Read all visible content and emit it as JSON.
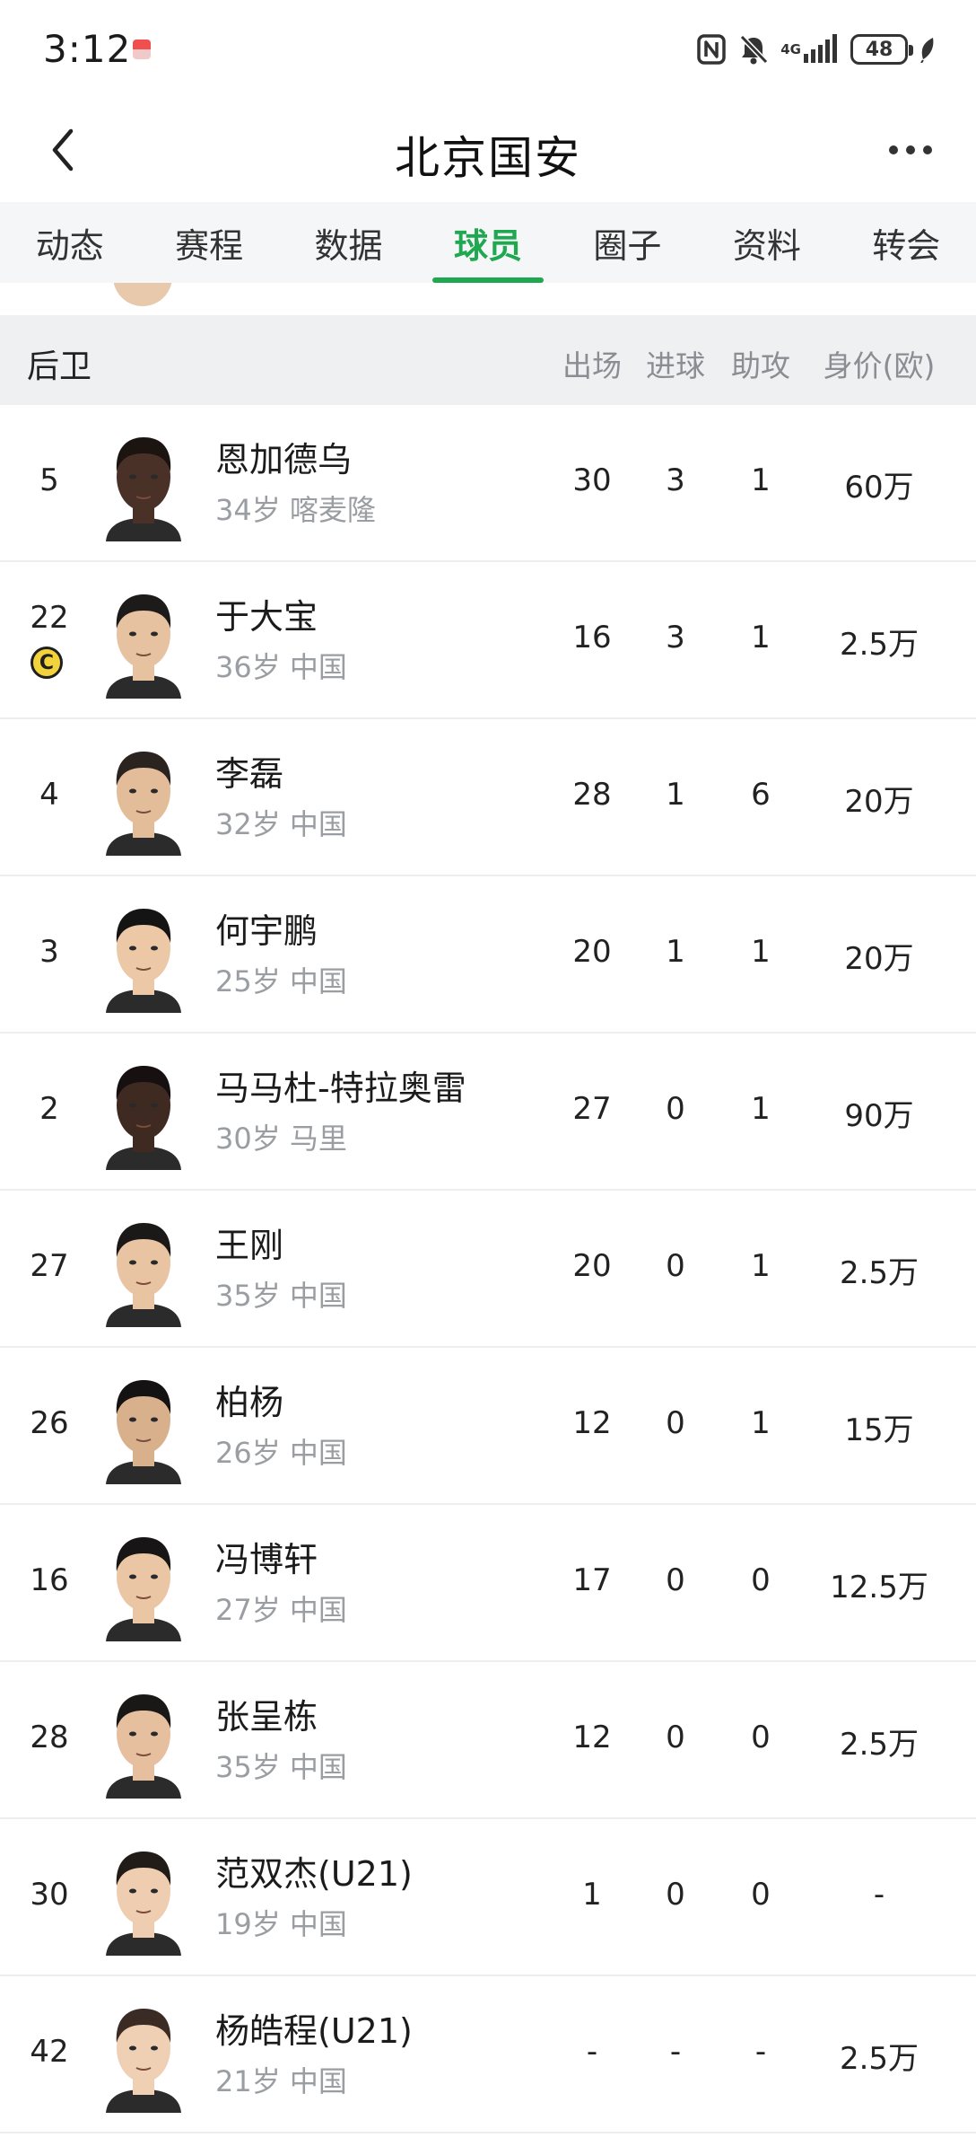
{
  "status_bar": {
    "time": "3:12",
    "network": "4G",
    "battery": "48"
  },
  "nav": {
    "title": "北京国安"
  },
  "tabs": [
    {
      "label": "动态",
      "active": false
    },
    {
      "label": "赛程",
      "active": false
    },
    {
      "label": "数据",
      "active": false
    },
    {
      "label": "球员",
      "active": true
    },
    {
      "label": "圈子",
      "active": false
    },
    {
      "label": "资料",
      "active": false
    },
    {
      "label": "转会",
      "active": false
    }
  ],
  "section": {
    "title": "后卫",
    "columns": {
      "apps": "出场",
      "goals": "进球",
      "assists": "助攻",
      "value": "身价(欧)"
    }
  },
  "players": [
    {
      "number": "5",
      "name": "恩加德乌",
      "meta": "34岁 喀麦隆",
      "apps": "30",
      "goals": "3",
      "assists": "1",
      "value": "60万",
      "captain": false,
      "skin": "#4a3127",
      "hair": "#1c1410"
    },
    {
      "number": "22",
      "name": "于大宝",
      "meta": "36岁 中国",
      "apps": "16",
      "goals": "3",
      "assists": "1",
      "value": "2.5万",
      "captain": true,
      "captain_mark": "C",
      "skin": "#e7c2a0",
      "hair": "#1d1b1a"
    },
    {
      "number": "4",
      "name": "李磊",
      "meta": "32岁 中国",
      "apps": "28",
      "goals": "1",
      "assists": "6",
      "value": "20万",
      "captain": false,
      "skin": "#e3bd99",
      "hair": "#2a2320"
    },
    {
      "number": "3",
      "name": "何宇鹏",
      "meta": "25岁 中国",
      "apps": "20",
      "goals": "1",
      "assists": "1",
      "value": "20万",
      "captain": false,
      "skin": "#ecc8a6",
      "hair": "#151414"
    },
    {
      "number": "2",
      "name": "马马杜-特拉奥雷",
      "meta": "30岁 马里",
      "apps": "27",
      "goals": "0",
      "assists": "1",
      "value": "90万",
      "captain": false,
      "skin": "#3f2a22",
      "hair": "#161010"
    },
    {
      "number": "27",
      "name": "王刚",
      "meta": "35岁 中国",
      "apps": "20",
      "goals": "0",
      "assists": "1",
      "value": "2.5万",
      "captain": false,
      "skin": "#e9c4a2",
      "hair": "#1b1918"
    },
    {
      "number": "26",
      "name": "柏杨",
      "meta": "26岁 中国",
      "apps": "12",
      "goals": "0",
      "assists": "1",
      "value": "15万",
      "captain": false,
      "skin": "#d8b08c",
      "hair": "#141212"
    },
    {
      "number": "16",
      "name": "冯博轩",
      "meta": "27岁 中国",
      "apps": "17",
      "goals": "0",
      "assists": "0",
      "value": "12.5万",
      "captain": false,
      "skin": "#ebc6a4",
      "hair": "#171515"
    },
    {
      "number": "28",
      "name": "张呈栋",
      "meta": "35岁 中国",
      "apps": "12",
      "goals": "0",
      "assists": "0",
      "value": "2.5万",
      "captain": false,
      "skin": "#e6c09e",
      "hair": "#1a1817"
    },
    {
      "number": "30",
      "name": "范双杰(U21)",
      "meta": "19岁 中国",
      "apps": "1",
      "goals": "0",
      "assists": "0",
      "value": "-",
      "captain": false,
      "skin": "#efcdb0",
      "hair": "#221c19"
    },
    {
      "number": "42",
      "name": "杨皓程(U21)",
      "meta": "21岁 中国",
      "apps": "-",
      "goals": "-",
      "assists": "-",
      "value": "2.5万",
      "captain": false,
      "skin": "#f0d0b4",
      "hair": "#3a2c24"
    }
  ],
  "colors": {
    "accent": "#1fa84f",
    "header_bg": "#eef0f2",
    "tab_bg": "#f5f6f7",
    "muted_text": "#9a9da1"
  },
  "icons": {
    "back": "chevron-left-icon",
    "more": "more-horizontal-icon",
    "nfc": "nfc-icon",
    "mute": "bell-off-icon",
    "signal": "signal-icon",
    "battery": "battery-icon",
    "leaf": "leaf-icon"
  }
}
